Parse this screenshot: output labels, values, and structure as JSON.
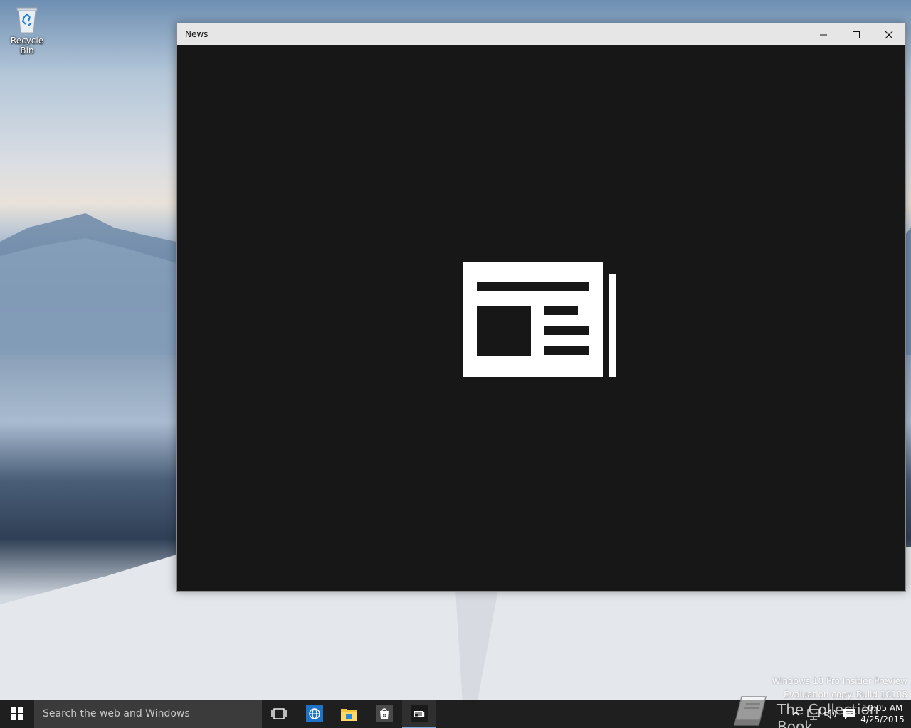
{
  "desktop": {
    "icons": [
      {
        "label": "Recycle Bin",
        "icon": "recycle-bin-icon"
      }
    ],
    "watermark": {
      "line1": "Windows 10 Pro Insider Preview",
      "line2": "Evaluation copy. Build 10108"
    },
    "overlay_logo_text": "The Collection Book"
  },
  "window": {
    "title": "News",
    "splash_icon": "newspaper-icon",
    "background_color": "#171717",
    "titlebar_color": "#e6e6e6",
    "buttons": {
      "minimize": "minimize-icon",
      "maximize": "maximize-icon",
      "close": "close-icon"
    }
  },
  "taskbar": {
    "search_placeholder": "Search the web and Windows",
    "pinned": [
      {
        "name": "Task View",
        "icon": "task-view-icon"
      },
      {
        "name": "Internet Explorer",
        "icon": "ie-icon"
      },
      {
        "name": "File Explorer",
        "icon": "folder-icon"
      },
      {
        "name": "Store",
        "icon": "store-icon"
      },
      {
        "name": "News",
        "icon": "news-icon",
        "active": true
      }
    ],
    "tray": {
      "icons": [
        "chevron-up-icon",
        "network-icon",
        "volume-icon",
        "action-center-icon"
      ],
      "time": "10:05 AM",
      "date": "4/25/2015"
    },
    "accent_color": "#7ba7d6"
  }
}
